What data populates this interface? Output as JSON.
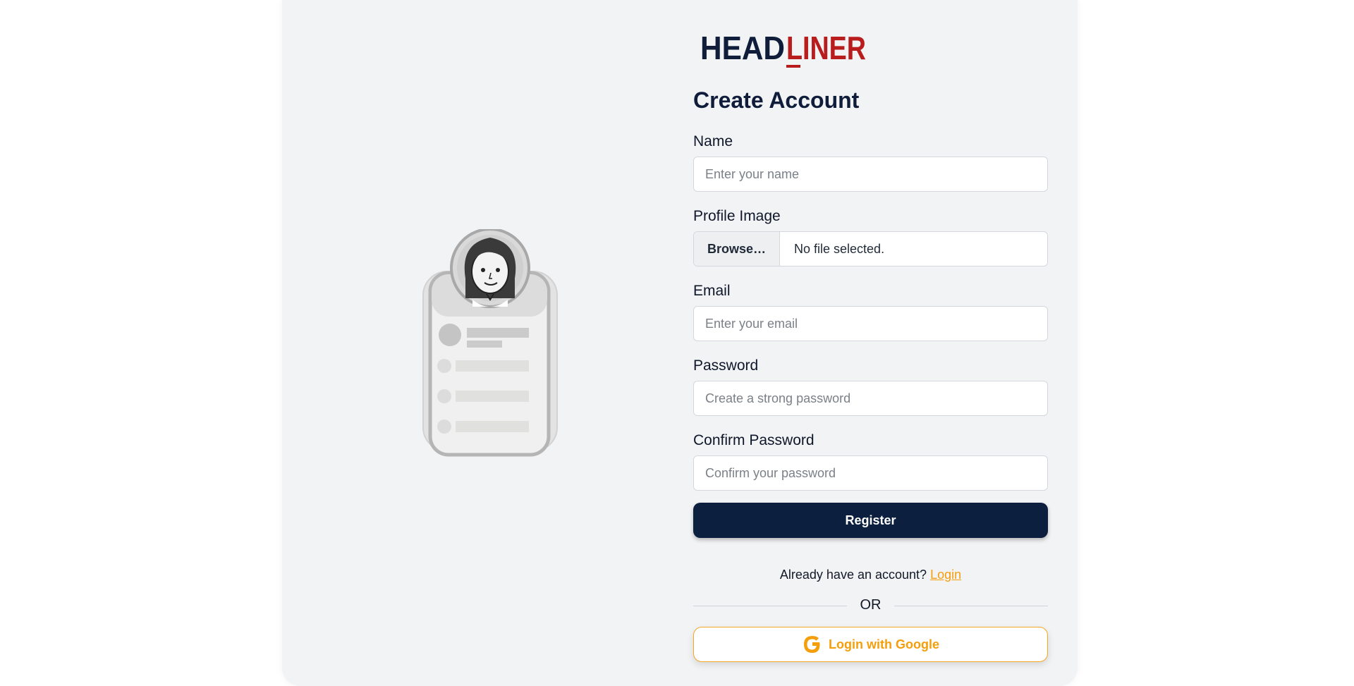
{
  "brand": {
    "part1": "HEAD",
    "part2": "LINER",
    "dark_color": "#0f1d3a",
    "accent_color": "#b91c1c"
  },
  "form": {
    "title": "Create Account",
    "name": {
      "label": "Name",
      "placeholder": "Enter your name"
    },
    "profile_image": {
      "label": "Profile Image",
      "browse_label": "Browse…",
      "status": "No file selected."
    },
    "email": {
      "label": "Email",
      "placeholder": "Enter your email"
    },
    "password": {
      "label": "Password",
      "placeholder": "Create a strong password"
    },
    "confirm_password": {
      "label": "Confirm Password",
      "placeholder": "Confirm your password"
    },
    "register_label": "Register",
    "already_text": "Already have an account?",
    "login_link": "Login",
    "divider_text": "OR",
    "google_label": "Login with Google"
  },
  "colors": {
    "primary": "#0c1f3f",
    "accent": "#f59e0b"
  },
  "icons": {
    "google": "google-g-icon",
    "illustration": "profile-card-illustration"
  }
}
